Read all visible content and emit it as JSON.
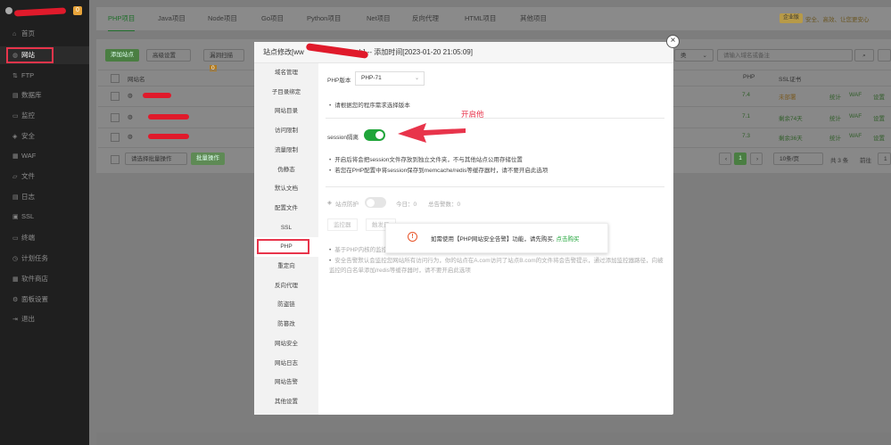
{
  "sidebar": {
    "badge": "0",
    "items": [
      {
        "label": "首页",
        "icon": "home-icon",
        "glyph": "⌂"
      },
      {
        "label": "网站",
        "icon": "globe-icon",
        "glyph": "◍"
      },
      {
        "label": "FTP",
        "icon": "ftp-icon",
        "glyph": "⇅"
      },
      {
        "label": "数据库",
        "icon": "database-icon",
        "glyph": "▤"
      },
      {
        "label": "监控",
        "icon": "monitor-icon",
        "glyph": "▭"
      },
      {
        "label": "安全",
        "icon": "shield-icon",
        "glyph": "◈"
      },
      {
        "label": "WAF",
        "icon": "waf-icon",
        "glyph": "▦"
      },
      {
        "label": "文件",
        "icon": "folder-icon",
        "glyph": "▱"
      },
      {
        "label": "日志",
        "icon": "log-icon",
        "glyph": "▤"
      },
      {
        "label": "SSL",
        "icon": "ssl-icon",
        "glyph": "▣"
      },
      {
        "label": "终端",
        "icon": "terminal-icon",
        "glyph": "▭"
      },
      {
        "label": "计划任务",
        "icon": "clock-icon",
        "glyph": "◷"
      },
      {
        "label": "软件商店",
        "icon": "store-icon",
        "glyph": "▦"
      },
      {
        "label": "面板设置",
        "icon": "gear-icon",
        "glyph": "⚙"
      },
      {
        "label": "退出",
        "icon": "logout-icon",
        "glyph": "⇥"
      }
    ]
  },
  "tabs": [
    "PHP项目",
    "Java项目",
    "Node项目",
    "Go项目",
    "Python项目",
    "Net项目",
    "反向代理",
    "HTML项目",
    "其他项目"
  ],
  "header_right": {
    "badge": "企业版",
    "text": "安全、高效、让您更安心"
  },
  "toolbar": {
    "add_site": "添加站点",
    "advanced": "高级设置",
    "expire": "漏洞扫描",
    "expire_badge": "0",
    "category_select": "类",
    "search_placeholder": "请输入域名或备注"
  },
  "table": {
    "headers": [
      "网站名",
      "PHP",
      "SSL证书"
    ],
    "rows": [
      {
        "php": "7.4",
        "ssl": "未部署",
        "ops": [
          "统计",
          "WAF",
          "设置"
        ]
      },
      {
        "php": "7.1",
        "ssl": "剩余74天",
        "ops": [
          "统计",
          "WAF",
          "设置"
        ]
      },
      {
        "php": "7.3",
        "ssl": "剩余36天",
        "ops": [
          "统计",
          "WAF",
          "设置"
        ]
      }
    ],
    "batch_select": "请选择批量操作",
    "batch_button": "批量操作",
    "pagination": {
      "current": "1",
      "per_page": "10条/页",
      "total": "共 3 条",
      "goto": "前往",
      "page": "1"
    }
  },
  "modal": {
    "title_prefix": "站点修改[ww",
    "title_suffix": "h] -- 添加时间[2023-01-20 21:05:09]",
    "menu": [
      "域名管理",
      "子目录绑定",
      "网站目录",
      "访问限制",
      "流量限制",
      "伪静态",
      "默认文档",
      "配置文件",
      "SSL",
      "PHP",
      "重定向",
      "反向代理",
      "防盗链",
      "防篡改",
      "网站安全",
      "网站日志",
      "网站告警",
      "其他设置"
    ],
    "active_menu_index": 9,
    "php_version_label": "PHP版本",
    "php_version_value": "PHP-71",
    "php_note": "请根据您的程序需求选择版本",
    "session_label": "session隔离",
    "session_enabled": true,
    "session_notes": [
      "开启后将会把session文件存放到独立文件夹，不与其他站点公用存储位置",
      "若您在PHP配置中将session保存到memcache/redis等缓存器时，请不要开启此选项"
    ],
    "guard_label": "站点防护",
    "guard_today": "今日：0",
    "guard_total": "总告警数：0",
    "guard_buttons": [
      "监控器",
      "触发日"
    ],
    "guard_notes": [
      "基于PHP内核的监控",
      "安全告警默认会监控您网站所有访问行为，你的站点在A.com访问了站点B.com的文件将会告警提示，通过添加监控器路径，向被监控的白名单添加/redis等缓存器时，请不要开启此选项"
    ]
  },
  "popup": {
    "message": "如需使用【PHP网站安全告警】功能，请先购买,",
    "link": "点击购买"
  },
  "annotation": "开启他",
  "colors": {
    "accent": "#20a53a",
    "annotation": "#e8344b"
  }
}
